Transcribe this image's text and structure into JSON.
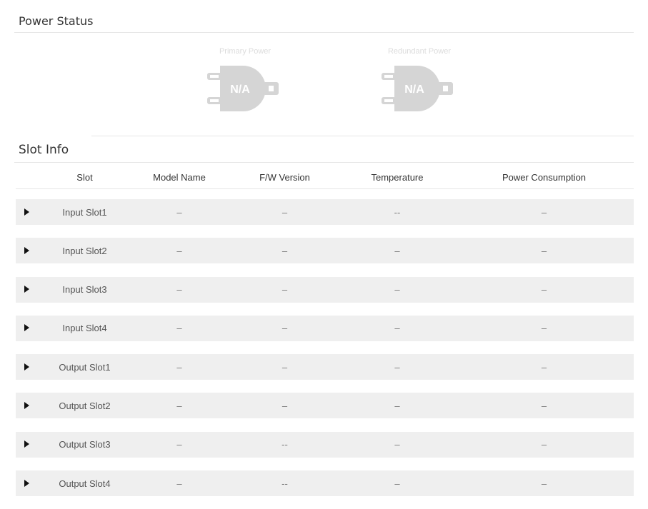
{
  "power_status": {
    "title": "Power Status",
    "primary": {
      "caption": "Primary Power",
      "status": "N/A"
    },
    "redundant": {
      "caption": "Redundant Power",
      "status": "N/A"
    }
  },
  "slot_info": {
    "title": "Slot Info",
    "columns": [
      "Slot",
      "Model Name",
      "F/W Version",
      "Temperature",
      "Power Consumption"
    ],
    "rows": [
      {
        "slot": "Input Slot1",
        "model": "–",
        "fw": "–",
        "temp": "--",
        "power": "–"
      },
      {
        "slot": "Input Slot2",
        "model": "–",
        "fw": "–",
        "temp": "–",
        "power": "–"
      },
      {
        "slot": "Input Slot3",
        "model": "–",
        "fw": "–",
        "temp": "–",
        "power": "–"
      },
      {
        "slot": "Input Slot4",
        "model": "–",
        "fw": "–",
        "temp": "–",
        "power": "–"
      },
      {
        "slot": "Output Slot1",
        "model": "–",
        "fw": "–",
        "temp": "–",
        "power": "–"
      },
      {
        "slot": "Output Slot2",
        "model": "–",
        "fw": "–",
        "temp": "–",
        "power": "–"
      },
      {
        "slot": "Output Slot3",
        "model": "–",
        "fw": "--",
        "temp": "–",
        "power": "–"
      },
      {
        "slot": "Output Slot4",
        "model": "–",
        "fw": "--",
        "temp": "–",
        "power": "–"
      }
    ]
  },
  "colors": {
    "plug_fill": "#d5d5d5",
    "row_bg": "#efefef",
    "rule": "#e6e6e6"
  },
  "icons": {
    "expand": "triangle-right-icon",
    "power": "power-plug-icon"
  }
}
